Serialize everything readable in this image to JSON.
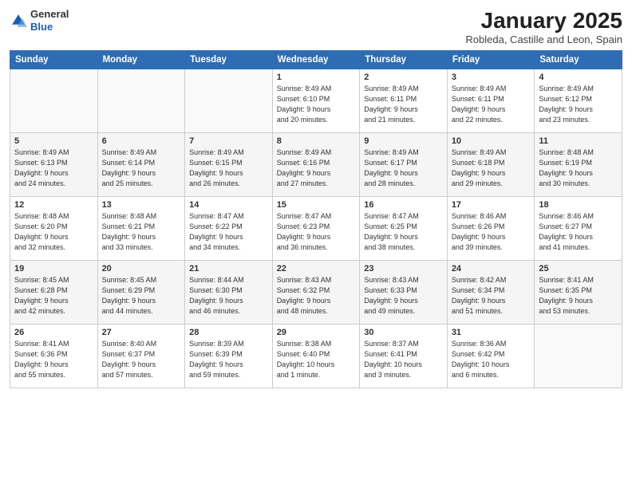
{
  "logo": {
    "general": "General",
    "blue": "Blue"
  },
  "title": "January 2025",
  "subtitle": "Robleda, Castille and Leon, Spain",
  "days_of_week": [
    "Sunday",
    "Monday",
    "Tuesday",
    "Wednesday",
    "Thursday",
    "Friday",
    "Saturday"
  ],
  "weeks": [
    [
      {
        "num": "",
        "text": ""
      },
      {
        "num": "",
        "text": ""
      },
      {
        "num": "",
        "text": ""
      },
      {
        "num": "1",
        "text": "Sunrise: 8:49 AM\nSunset: 6:10 PM\nDaylight: 9 hours\nand 20 minutes."
      },
      {
        "num": "2",
        "text": "Sunrise: 8:49 AM\nSunset: 6:11 PM\nDaylight: 9 hours\nand 21 minutes."
      },
      {
        "num": "3",
        "text": "Sunrise: 8:49 AM\nSunset: 6:11 PM\nDaylight: 9 hours\nand 22 minutes."
      },
      {
        "num": "4",
        "text": "Sunrise: 8:49 AM\nSunset: 6:12 PM\nDaylight: 9 hours\nand 23 minutes."
      }
    ],
    [
      {
        "num": "5",
        "text": "Sunrise: 8:49 AM\nSunset: 6:13 PM\nDaylight: 9 hours\nand 24 minutes."
      },
      {
        "num": "6",
        "text": "Sunrise: 8:49 AM\nSunset: 6:14 PM\nDaylight: 9 hours\nand 25 minutes."
      },
      {
        "num": "7",
        "text": "Sunrise: 8:49 AM\nSunset: 6:15 PM\nDaylight: 9 hours\nand 26 minutes."
      },
      {
        "num": "8",
        "text": "Sunrise: 8:49 AM\nSunset: 6:16 PM\nDaylight: 9 hours\nand 27 minutes."
      },
      {
        "num": "9",
        "text": "Sunrise: 8:49 AM\nSunset: 6:17 PM\nDaylight: 9 hours\nand 28 minutes."
      },
      {
        "num": "10",
        "text": "Sunrise: 8:49 AM\nSunset: 6:18 PM\nDaylight: 9 hours\nand 29 minutes."
      },
      {
        "num": "11",
        "text": "Sunrise: 8:48 AM\nSunset: 6:19 PM\nDaylight: 9 hours\nand 30 minutes."
      }
    ],
    [
      {
        "num": "12",
        "text": "Sunrise: 8:48 AM\nSunset: 6:20 PM\nDaylight: 9 hours\nand 32 minutes."
      },
      {
        "num": "13",
        "text": "Sunrise: 8:48 AM\nSunset: 6:21 PM\nDaylight: 9 hours\nand 33 minutes."
      },
      {
        "num": "14",
        "text": "Sunrise: 8:47 AM\nSunset: 6:22 PM\nDaylight: 9 hours\nand 34 minutes."
      },
      {
        "num": "15",
        "text": "Sunrise: 8:47 AM\nSunset: 6:23 PM\nDaylight: 9 hours\nand 36 minutes."
      },
      {
        "num": "16",
        "text": "Sunrise: 8:47 AM\nSunset: 6:25 PM\nDaylight: 9 hours\nand 38 minutes."
      },
      {
        "num": "17",
        "text": "Sunrise: 8:46 AM\nSunset: 6:26 PM\nDaylight: 9 hours\nand 39 minutes."
      },
      {
        "num": "18",
        "text": "Sunrise: 8:46 AM\nSunset: 6:27 PM\nDaylight: 9 hours\nand 41 minutes."
      }
    ],
    [
      {
        "num": "19",
        "text": "Sunrise: 8:45 AM\nSunset: 6:28 PM\nDaylight: 9 hours\nand 42 minutes."
      },
      {
        "num": "20",
        "text": "Sunrise: 8:45 AM\nSunset: 6:29 PM\nDaylight: 9 hours\nand 44 minutes."
      },
      {
        "num": "21",
        "text": "Sunrise: 8:44 AM\nSunset: 6:30 PM\nDaylight: 9 hours\nand 46 minutes."
      },
      {
        "num": "22",
        "text": "Sunrise: 8:43 AM\nSunset: 6:32 PM\nDaylight: 9 hours\nand 48 minutes."
      },
      {
        "num": "23",
        "text": "Sunrise: 8:43 AM\nSunset: 6:33 PM\nDaylight: 9 hours\nand 49 minutes."
      },
      {
        "num": "24",
        "text": "Sunrise: 8:42 AM\nSunset: 6:34 PM\nDaylight: 9 hours\nand 51 minutes."
      },
      {
        "num": "25",
        "text": "Sunrise: 8:41 AM\nSunset: 6:35 PM\nDaylight: 9 hours\nand 53 minutes."
      }
    ],
    [
      {
        "num": "26",
        "text": "Sunrise: 8:41 AM\nSunset: 6:36 PM\nDaylight: 9 hours\nand 55 minutes."
      },
      {
        "num": "27",
        "text": "Sunrise: 8:40 AM\nSunset: 6:37 PM\nDaylight: 9 hours\nand 57 minutes."
      },
      {
        "num": "28",
        "text": "Sunrise: 8:39 AM\nSunset: 6:39 PM\nDaylight: 9 hours\nand 59 minutes."
      },
      {
        "num": "29",
        "text": "Sunrise: 8:38 AM\nSunset: 6:40 PM\nDaylight: 10 hours\nand 1 minute."
      },
      {
        "num": "30",
        "text": "Sunrise: 8:37 AM\nSunset: 6:41 PM\nDaylight: 10 hours\nand 3 minutes."
      },
      {
        "num": "31",
        "text": "Sunrise: 8:36 AM\nSunset: 6:42 PM\nDaylight: 10 hours\nand 6 minutes."
      },
      {
        "num": "",
        "text": ""
      }
    ]
  ]
}
